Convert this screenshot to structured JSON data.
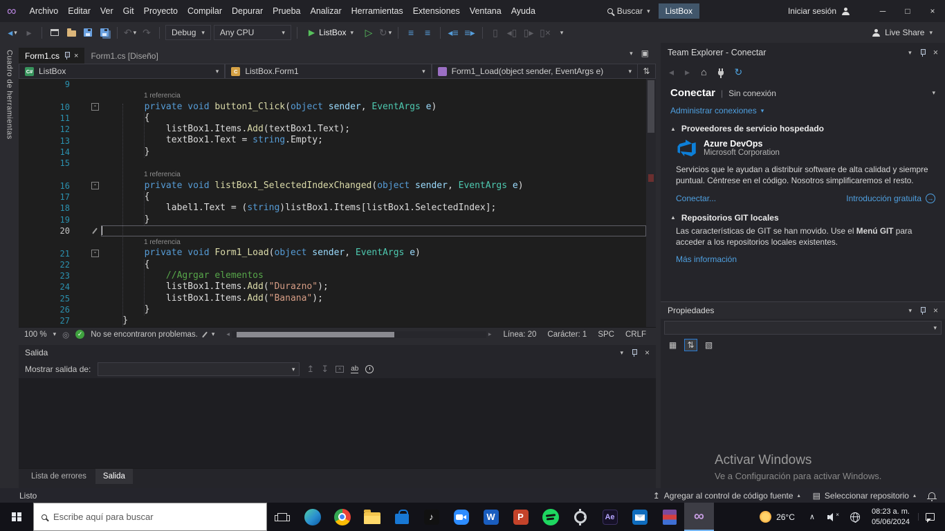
{
  "title_bar": {
    "menus": [
      "Archivo",
      "Editar",
      "Ver",
      "Git",
      "Proyecto",
      "Compilar",
      "Depurar",
      "Prueba",
      "Analizar",
      "Herramientas",
      "Extensiones",
      "Ventana",
      "Ayuda"
    ],
    "search_label": "Buscar",
    "search_value": "ListBox",
    "sign_in": "Iniciar sesión"
  },
  "toolbar": {
    "debug_config": "Debug",
    "platform": "Any CPU",
    "run_target": "ListBox",
    "live_share": "Live Share"
  },
  "editor": {
    "tabs": [
      {
        "label": "Form1.cs",
        "active": true
      },
      {
        "label": "Form1.cs [Diseño]",
        "active": false
      }
    ],
    "navigation": {
      "project": "ListBox",
      "type": "ListBox.Form1",
      "member": "Form1_Load(object sender, EventArgs e)"
    },
    "reference_label": "1 referencia",
    "rows": [
      {
        "n": "9"
      },
      {
        "ref": true
      },
      {
        "n": "10",
        "fold": true,
        "tokens": [
          [
            "        ",
            "p"
          ],
          [
            "private",
            "k"
          ],
          [
            " ",
            "p"
          ],
          [
            "void",
            "k"
          ],
          [
            " ",
            "p"
          ],
          [
            "button1_Click",
            "m"
          ],
          [
            "(",
            "p"
          ],
          [
            "object",
            "k"
          ],
          [
            " ",
            "p"
          ],
          [
            "sender",
            "v"
          ],
          [
            ", ",
            "p"
          ],
          [
            "EventArgs",
            "t"
          ],
          [
            " ",
            "p"
          ],
          [
            "e",
            "v"
          ],
          [
            ")",
            "p"
          ]
        ]
      },
      {
        "n": "11",
        "tokens": [
          [
            "        {",
            "p"
          ]
        ]
      },
      {
        "n": "12",
        "tokens": [
          [
            "            listBox1.Items.",
            "p"
          ],
          [
            "Add",
            "m"
          ],
          [
            "(textBox1.Text);",
            "p"
          ]
        ]
      },
      {
        "n": "13",
        "tokens": [
          [
            "            textBox1.Text = ",
            "p"
          ],
          [
            "string",
            "k"
          ],
          [
            ".Empty;",
            "p"
          ]
        ]
      },
      {
        "n": "14",
        "tokens": [
          [
            "        }",
            "p"
          ]
        ]
      },
      {
        "n": "15"
      },
      {
        "ref": true
      },
      {
        "n": "16",
        "fold": true,
        "tokens": [
          [
            "        ",
            "p"
          ],
          [
            "private",
            "k"
          ],
          [
            " ",
            "p"
          ],
          [
            "void",
            "k"
          ],
          [
            " ",
            "p"
          ],
          [
            "listBox1_SelectedIndexChanged",
            "m"
          ],
          [
            "(",
            "p"
          ],
          [
            "object",
            "k"
          ],
          [
            " ",
            "p"
          ],
          [
            "sender",
            "v"
          ],
          [
            ", ",
            "p"
          ],
          [
            "EventArgs",
            "t"
          ],
          [
            " ",
            "p"
          ],
          [
            "e",
            "v"
          ],
          [
            ")",
            "p"
          ]
        ]
      },
      {
        "n": "17",
        "tokens": [
          [
            "        {",
            "p"
          ]
        ]
      },
      {
        "n": "18",
        "tokens": [
          [
            "            label1.Text = (",
            "p"
          ],
          [
            "string",
            "k"
          ],
          [
            ")listBox1.Items[listBox1.SelectedIndex];",
            "p"
          ]
        ]
      },
      {
        "n": "19",
        "tokens": [
          [
            "        }",
            "p"
          ]
        ]
      },
      {
        "n": "20",
        "current": true,
        "pencil": true
      },
      {
        "ref": true
      },
      {
        "n": "21",
        "fold": true,
        "tokens": [
          [
            "        ",
            "p"
          ],
          [
            "private",
            "k"
          ],
          [
            " ",
            "p"
          ],
          [
            "void",
            "k"
          ],
          [
            " ",
            "p"
          ],
          [
            "Form1_Load",
            "m"
          ],
          [
            "(",
            "p"
          ],
          [
            "object",
            "k"
          ],
          [
            " ",
            "p"
          ],
          [
            "sender",
            "v"
          ],
          [
            ", ",
            "p"
          ],
          [
            "EventArgs",
            "t"
          ],
          [
            " ",
            "p"
          ],
          [
            "e",
            "v"
          ],
          [
            ")",
            "p"
          ]
        ]
      },
      {
        "n": "22",
        "tokens": [
          [
            "        {",
            "p"
          ]
        ]
      },
      {
        "n": "23",
        "tokens": [
          [
            "            ",
            "p"
          ],
          [
            "//Agrgar elementos",
            "c"
          ]
        ]
      },
      {
        "n": "24",
        "tokens": [
          [
            "            listBox1.Items.",
            "p"
          ],
          [
            "Add",
            "m"
          ],
          [
            "(",
            "p"
          ],
          [
            "\"Durazno\"",
            "s"
          ],
          [
            ");",
            "p"
          ]
        ]
      },
      {
        "n": "25",
        "tokens": [
          [
            "            listBox1.Items.",
            "p"
          ],
          [
            "Add",
            "m"
          ],
          [
            "(",
            "p"
          ],
          [
            "\"Banana\"",
            "s"
          ],
          [
            ");",
            "p"
          ]
        ]
      },
      {
        "n": "26",
        "tokens": [
          [
            "        }",
            "p"
          ]
        ]
      },
      {
        "n": "27",
        "tokens": [
          [
            "    }",
            "p"
          ]
        ]
      }
    ],
    "status": {
      "zoom": "100 %",
      "message": "No se encontraron problemas.",
      "line_label": "Línea: 20",
      "char_label": "Carácter: 1",
      "spaces": "SPC",
      "line_ending": "CRLF"
    }
  },
  "output_panel": {
    "title": "Salida",
    "show_output_label": "Mostrar salida de:",
    "tabs": [
      {
        "label": "Lista de errores",
        "active": false
      },
      {
        "label": "Salida",
        "active": true
      }
    ]
  },
  "team_explorer": {
    "title": "Team Explorer - Conectar",
    "heading": "Conectar",
    "connection_status": "Sin conexión",
    "manage_connections": "Administrar conexiones",
    "hosted": {
      "title": "Proveedores de servicio hospedado",
      "provider_name": "Azure DevOps",
      "provider_company": "Microsoft Corporation",
      "description": "Servicios que le ayudan a distribuir software de alta calidad y siempre puntual. Céntrese en el código. Nosotros simplificaremos el resto.",
      "connect_link": "Conectar...",
      "intro_link": "Introducción gratuita"
    },
    "git": {
      "title": "Repositorios GIT locales",
      "text_pre": "Las características de GIT se han movido. Use el ",
      "text_bold": "Menú GIT",
      "text_post": " para acceder a los repositorios locales existentes.",
      "more_link": "Más información"
    }
  },
  "properties_panel": {
    "title": "Propiedades"
  },
  "watermark": {
    "line1": "Activar Windows",
    "line2": "Ve a Configuración para activar Windows."
  },
  "status_bar": {
    "ready": "Listo",
    "add_source_control": "Agregar al control de código fuente",
    "select_repo": "Seleccionar repositorio"
  },
  "left_strip": {
    "label": "Cuadro de herramientas"
  },
  "taskbar": {
    "search_placeholder": "Escribe aquí para buscar",
    "weather_temp": "26°C",
    "time": "08:23 a. m.",
    "date": "05/06/2024"
  }
}
